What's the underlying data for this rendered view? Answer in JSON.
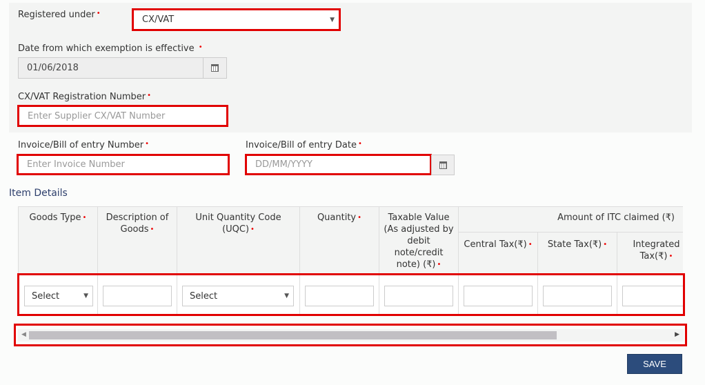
{
  "form": {
    "registered_under": {
      "label": "Registered under",
      "value": "CX/VAT"
    },
    "exemption_date": {
      "label": "Date from which exemption is effective",
      "value": "01/06/2018",
      "icon": "calendar-icon"
    },
    "registration_number": {
      "label": "CX/VAT Registration Number",
      "placeholder": "Enter Supplier CX/VAT Number"
    },
    "invoice_number": {
      "label": "Invoice/Bill of entry Number",
      "placeholder": "Enter Invoice Number"
    },
    "invoice_date": {
      "label": "Invoice/Bill of entry Date",
      "placeholder": "DD/MM/YYYY",
      "icon": "calendar-icon"
    },
    "required_marker": "•"
  },
  "item_details": {
    "title": "Item Details",
    "group_header": "Amount of ITC claimed (₹)",
    "columns": [
      {
        "label": "Goods Type",
        "input": "select",
        "value": "Select"
      },
      {
        "label": "Description of Goods",
        "input": "text",
        "value": ""
      },
      {
        "label": "Unit Quantity Code (UQC)",
        "input": "select",
        "value": "Select"
      },
      {
        "label": "Quantity",
        "input": "text",
        "value": ""
      },
      {
        "label": "Taxable Value (As adjusted by debit note/credit note) (₹)",
        "input": "text",
        "value": ""
      },
      {
        "label": "Central Tax(₹)",
        "input": "text",
        "value": ""
      },
      {
        "label": "State Tax(₹)",
        "input": "text",
        "value": ""
      },
      {
        "label": "Integrated Tax(₹)",
        "input": "text",
        "value": ""
      }
    ],
    "caret": "▼"
  },
  "scrollbar": {
    "left_arrow": "◀",
    "right_arrow": "▶"
  },
  "actions": {
    "save_label": "SAVE"
  },
  "colors": {
    "highlight": "#e10000",
    "primary_button": "#2c4c7c",
    "required": "#e00000"
  }
}
